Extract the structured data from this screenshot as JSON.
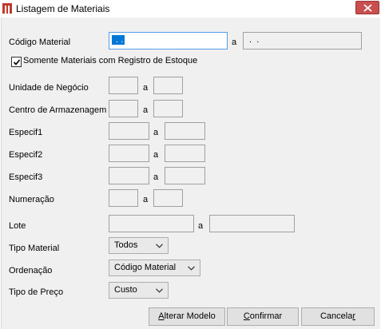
{
  "window": {
    "title": "Listagem de Materiais"
  },
  "form": {
    "codigo_material": {
      "label": "Código Material",
      "from_value": " . .",
      "sep": "a",
      "to_value": " .  ."
    },
    "somente_estoque": {
      "label": "Somente Materiais com Registro de Estoque",
      "checked": true
    },
    "unidade_negocio": {
      "label": "Unidade de Negócio",
      "sep": "a",
      "from_value": "",
      "to_value": ""
    },
    "centro_armazenagem": {
      "label": "Centro de Armazenagem",
      "sep": "a",
      "from_value": "",
      "to_value": ""
    },
    "especif1": {
      "label": "Especif1",
      "sep": "a",
      "from_value": "",
      "to_value": ""
    },
    "especif2": {
      "label": "Especif2",
      "sep": "a",
      "from_value": "",
      "to_value": ""
    },
    "especif3": {
      "label": "Especif3",
      "sep": "a",
      "from_value": "",
      "to_value": ""
    },
    "numeracao": {
      "label": "Numeração",
      "sep": "a",
      "from_value": "",
      "to_value": ""
    },
    "lote": {
      "label": "Lote",
      "sep": "a",
      "from_value": "",
      "to_value": ""
    },
    "tipo_material": {
      "label": "Tipo Material",
      "selected": "Todos"
    },
    "ordenacao": {
      "label": "Ordenação",
      "selected": "Código Material"
    },
    "tipo_preco": {
      "label": "Tipo de Preço",
      "selected": "Custo"
    }
  },
  "buttons": {
    "alterar_modelo": {
      "mnemonic": "A",
      "rest": "lterar Modelo"
    },
    "confirmar": {
      "mnemonic": "C",
      "rest": "onfirmar"
    },
    "cancelar": {
      "prefix": "Cancela",
      "mnemonic": "r"
    }
  },
  "colors": {
    "close_button": "#c94f4f",
    "selection": "#0078d7",
    "app_icon": "#c0392b"
  },
  "icons": {
    "app": "app-logo-icon",
    "close": "close-icon",
    "check": "checkmark-icon",
    "dropdown": "chevron-down-icon"
  }
}
